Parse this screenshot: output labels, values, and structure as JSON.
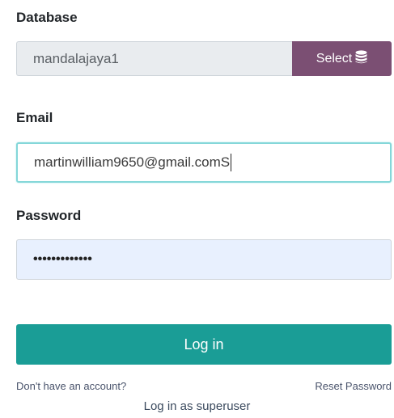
{
  "form": {
    "database_label": "Database",
    "database_value": "mandalajaya1",
    "select_label": "Select",
    "select_icon": "database-icon",
    "email_label": "Email",
    "email_value": "martinwilliam9650@gmail.comS",
    "password_label": "Password",
    "password_masked": "•••••••••••••",
    "login_label": "Log in"
  },
  "links": {
    "signup": "Don't have an account?",
    "reset": "Reset Password",
    "superuser": "Log in as superuser"
  },
  "colors": {
    "accent": "#1a9d96",
    "select_button": "#7b4f73",
    "email_focus_border": "#84d7d9",
    "autofill_background": "#e8f0fe"
  }
}
